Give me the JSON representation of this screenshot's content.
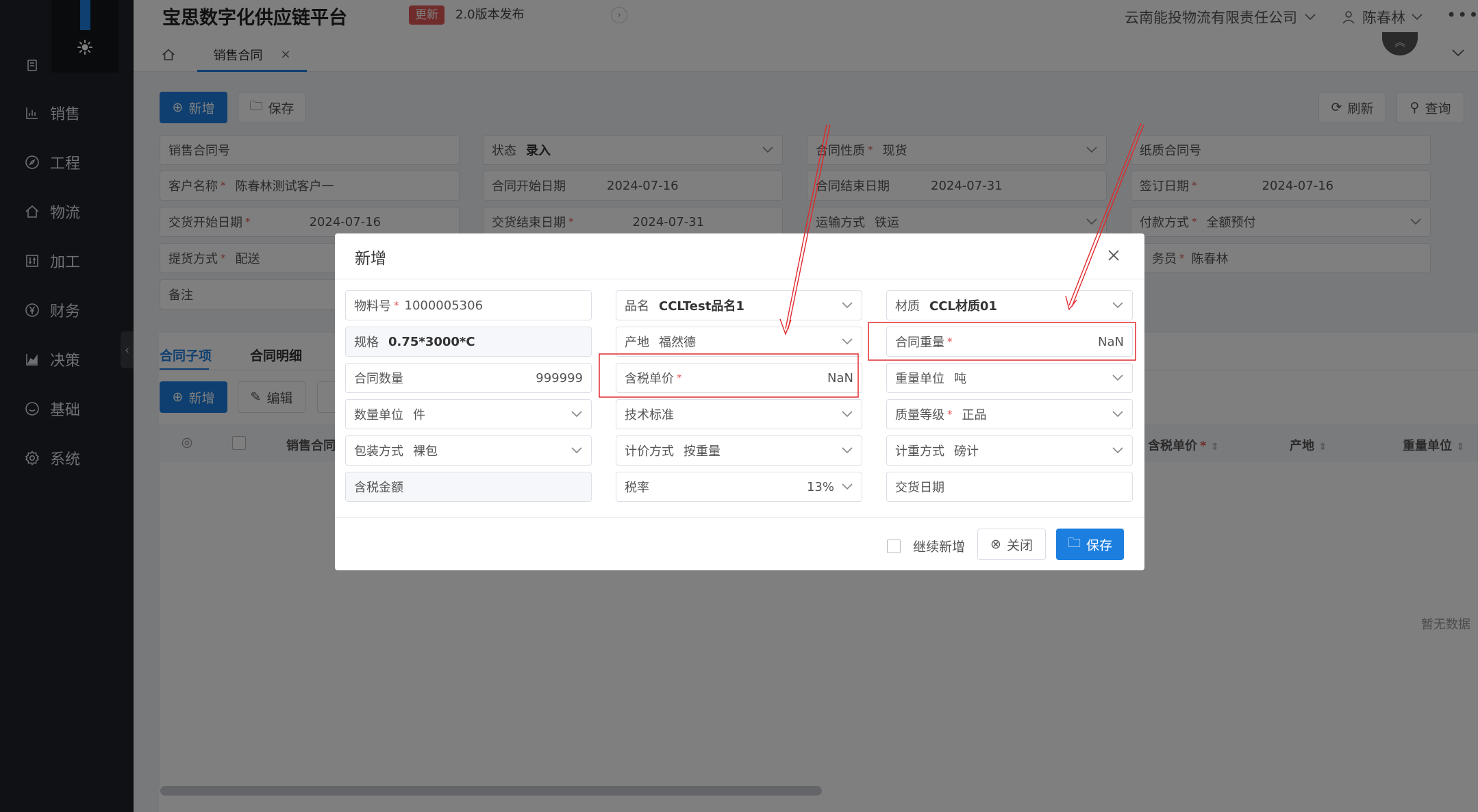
{
  "header": {
    "app_title": "宝思数字化供应链平台",
    "badge": "更新",
    "release_text": "2.0版本发布",
    "company": "云南能投物流有限责任公司",
    "user_name": "陈春林"
  },
  "sidebar": {
    "items": [
      {
        "label": "",
        "icon": "trash-icon"
      },
      {
        "label": "销售",
        "icon": "bar-chart-icon"
      },
      {
        "label": "工程",
        "icon": "compass-icon"
      },
      {
        "label": "物流",
        "icon": "home-icon"
      },
      {
        "label": "加工",
        "icon": "equalizer-icon"
      },
      {
        "label": "财务",
        "icon": "yen-icon"
      },
      {
        "label": "决策",
        "icon": "area-chart-icon"
      },
      {
        "label": "基础",
        "icon": "smile-icon"
      },
      {
        "label": "系统",
        "icon": "gear-icon"
      }
    ]
  },
  "tabs": {
    "active_tab": "销售合同",
    "close_glyph": "×"
  },
  "toolbar": {
    "add": "新增",
    "save": "保存",
    "refresh": "刷新",
    "query": "查询"
  },
  "form": {
    "contract_no": {
      "label": "销售合同号"
    },
    "status": {
      "label": "状态",
      "value": "录入"
    },
    "contract_nature": {
      "label": "合同性质",
      "value": "现货"
    },
    "paper_contract_no": {
      "label": "纸质合同号"
    },
    "customer_name": {
      "label": "客户名称",
      "value": "陈春林测试客户一"
    },
    "contract_start": {
      "label": "合同开始日期",
      "value": "2024-07-16"
    },
    "contract_end": {
      "label": "合同结束日期",
      "value": "2024-07-31"
    },
    "sign_date": {
      "label": "签订日期",
      "value": "2024-07-16"
    },
    "delivery_start": {
      "label": "交货开始日期",
      "value": "2024-07-16"
    },
    "delivery_end": {
      "label": "交货结束日期",
      "value": "2024-07-31"
    },
    "transport": {
      "label": "运输方式",
      "value": "铁运"
    },
    "payment": {
      "label": "付款方式",
      "value": "全额预付"
    },
    "pickup": {
      "label": "提货方式",
      "value": "配送"
    },
    "salesman": {
      "label": "务员",
      "value": "陈春林"
    },
    "remark": {
      "label": "备注"
    }
  },
  "subtabs": {
    "items": [
      "合同子项",
      "合同明细"
    ],
    "add": "新增",
    "edit": "编辑"
  },
  "table": {
    "columns": [
      "销售合同",
      "含税单价",
      "产地",
      "重量单位"
    ],
    "empty": "暂无数据"
  },
  "modal": {
    "title": "新增",
    "fields": {
      "material_no": {
        "label": "物料号",
        "value": "1000005306"
      },
      "product_name": {
        "label": "品名",
        "value": "CCLTest品名1"
      },
      "material": {
        "label": "材质",
        "value": "CCL材质01"
      },
      "spec": {
        "label": "规格",
        "value": "0.75*3000*C"
      },
      "origin": {
        "label": "产地",
        "value": "福然德"
      },
      "contract_weight": {
        "label": "合同重量",
        "value": "NaN"
      },
      "contract_qty": {
        "label": "合同数量",
        "value": "999999"
      },
      "tax_price": {
        "label": "含税单价",
        "value": "NaN"
      },
      "weight_unit": {
        "label": "重量单位",
        "value": "吨"
      },
      "qty_unit": {
        "label": "数量单位",
        "value": "件"
      },
      "tech_standard": {
        "label": "技术标准"
      },
      "quality_grade": {
        "label": "质量等级",
        "value": "正品"
      },
      "packing": {
        "label": "包装方式",
        "value": "裸包"
      },
      "pricing": {
        "label": "计价方式",
        "value": "按重量"
      },
      "metering": {
        "label": "计重方式",
        "value": "磅计"
      },
      "tax_amount": {
        "label": "含税金额"
      },
      "tax_rate": {
        "label": "税率",
        "value": "13%"
      },
      "delivery_date": {
        "label": "交货日期"
      }
    },
    "continue_label": "继续新增",
    "close_label": "关闭",
    "save_label": "保存"
  },
  "colors": {
    "primary": "#1c7fe0",
    "sidebar": "#1f2229",
    "required": "#e05656",
    "annotation": "#e0292d"
  }
}
